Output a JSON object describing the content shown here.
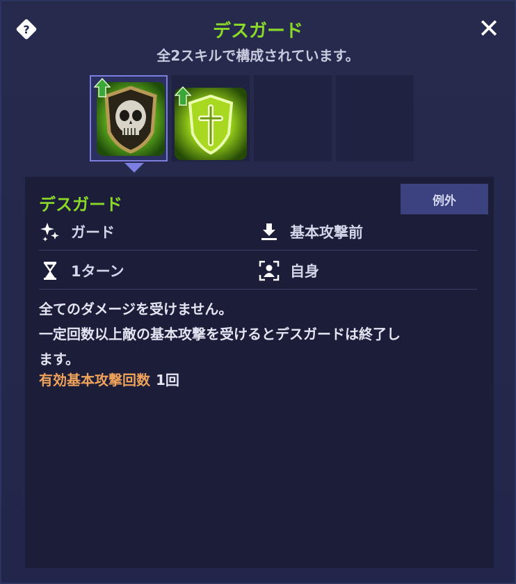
{
  "header": {
    "title": "デスガード",
    "subtitle": "全2スキルで構成されています。"
  },
  "skills": [
    {
      "icon": "skull-shield-icon",
      "upgraded": true,
      "selected": true
    },
    {
      "icon": "cross-shield-icon",
      "upgraded": true,
      "selected": false
    },
    {
      "icon": "empty-slot",
      "upgraded": false,
      "selected": false
    },
    {
      "icon": "empty-slot",
      "upgraded": false,
      "selected": false
    }
  ],
  "detail": {
    "name": "デスガード",
    "tag": "例外",
    "attributes": {
      "type": "ガード",
      "timing": "基本攻撃前",
      "duration": "1ターン",
      "target": "自身"
    },
    "description_lines": [
      "全てのダメージを受けません。",
      "一定回数以上敵の基本攻撃を受けるとデスガードは終了し",
      "ます。"
    ],
    "effect": {
      "label": "有効基本攻撃回数",
      "value": "1回"
    }
  },
  "colors": {
    "title_green": "#8ad82a",
    "effect_orange": "#f0a35a",
    "selected_border": "#7c7ee0"
  }
}
